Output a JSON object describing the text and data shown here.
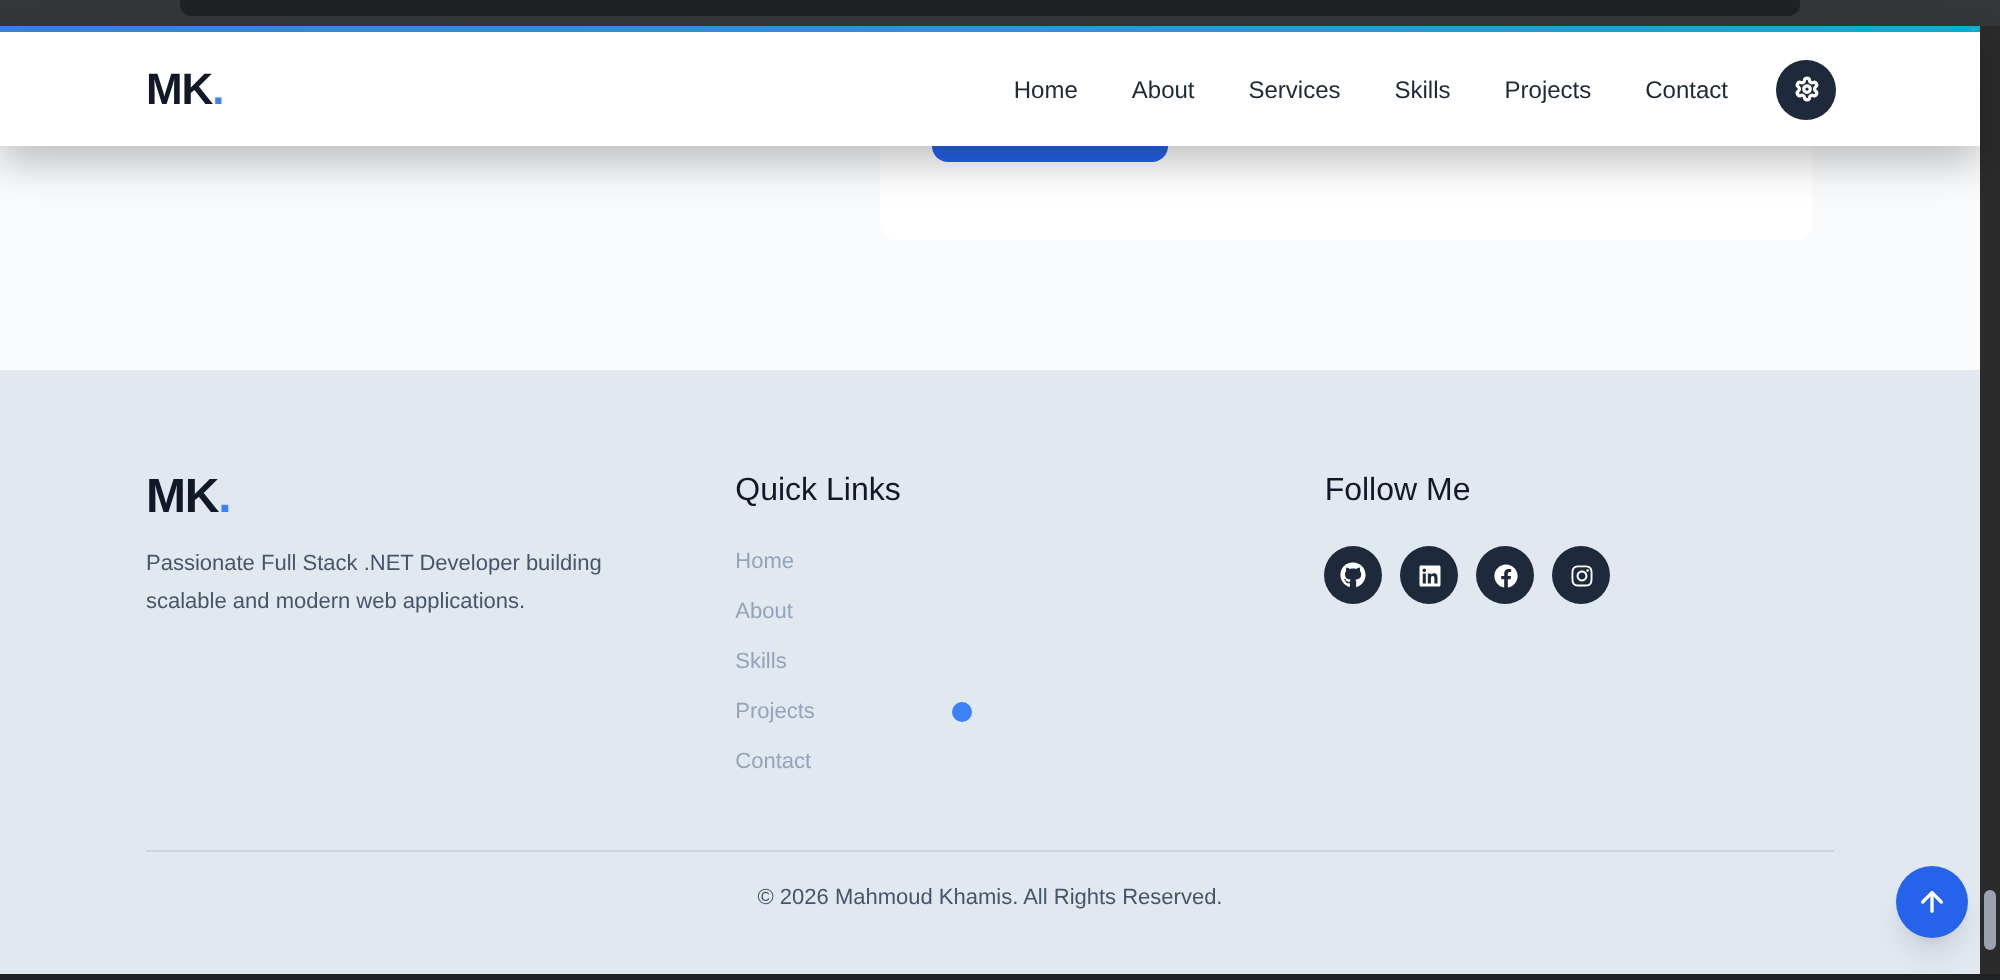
{
  "navbar": {
    "logo": "MK",
    "logo_dot": ".",
    "links": [
      {
        "label": "Home"
      },
      {
        "label": "About"
      },
      {
        "label": "Services"
      },
      {
        "label": "Skills"
      },
      {
        "label": "Projects"
      },
      {
        "label": "Contact"
      }
    ]
  },
  "footer": {
    "logo": "MK",
    "logo_dot": ".",
    "description": "Passionate Full Stack .NET Developer building scalable and modern web applications.",
    "quick_links": {
      "title": "Quick Links",
      "links": [
        "Home",
        "About",
        "Skills",
        "Projects",
        "Contact"
      ]
    },
    "follow": {
      "title": "Follow Me",
      "socials": [
        {
          "kind": "github"
        },
        {
          "kind": "linkedin"
        },
        {
          "kind": "facebook"
        },
        {
          "kind": "instagram"
        }
      ]
    },
    "copyright": "© 2026 Mahmoud Khamis. All Rights Reserved."
  }
}
